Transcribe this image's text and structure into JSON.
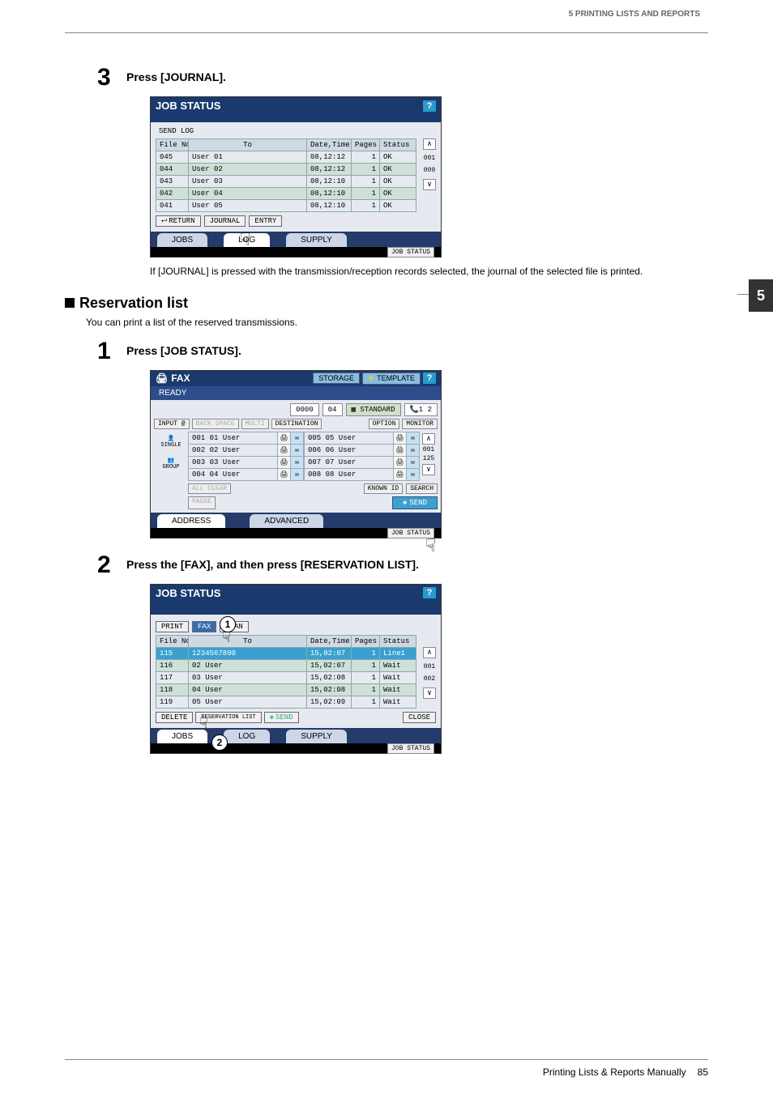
{
  "header": {
    "chapter_title": "5 PRINTING LISTS AND REPORTS",
    "side_tab": "5"
  },
  "step3": {
    "num": "3",
    "text": "Press [JOURNAL].",
    "note": "If [JOURNAL] is pressed with the transmission/reception records selected, the journal of the selected file is printed."
  },
  "jobstatus1": {
    "title": "JOB STATUS",
    "help": "?",
    "sublabel": "SEND LOG",
    "cols": {
      "file": "File No.",
      "to": "To",
      "datetime": "Date,Time",
      "pages": "Pages",
      "status": "Status"
    },
    "rows": [
      {
        "file": "045",
        "to": "User 01",
        "dt": "08,12:12",
        "pg": "1",
        "st": "OK"
      },
      {
        "file": "044",
        "to": "User 02",
        "dt": "08,12:12",
        "pg": "1",
        "st": "OK"
      },
      {
        "file": "043",
        "to": "User 03",
        "dt": "08,12:10",
        "pg": "1",
        "st": "OK"
      },
      {
        "file": "042",
        "to": "User 04",
        "dt": "08,12:10",
        "pg": "1",
        "st": "OK"
      },
      {
        "file": "041",
        "to": "User 05",
        "dt": "08,12:10",
        "pg": "1",
        "st": "OK"
      }
    ],
    "scroll": {
      "top": "001",
      "bot": "009"
    },
    "btns": {
      "return": "RETURN",
      "journal": "JOURNAL",
      "entry": "ENTRY"
    },
    "tabs": {
      "jobs": "JOBS",
      "log": "LOG",
      "supply": "SUPPLY"
    },
    "pill": "JOB STATUS"
  },
  "section": {
    "title": "Reservation list",
    "desc": "You can print a list of the reserved transmissions."
  },
  "step1": {
    "num": "1",
    "text": "Press [JOB STATUS]."
  },
  "fax": {
    "title": "FAX",
    "storage": "STORAGE",
    "template": "TEMPLATE",
    "help": "?",
    "ready": "READY",
    "disp_num": "0000",
    "disp_pg": "04",
    "standard": "STANDARD",
    "lines": "1 2",
    "input": "INPUT @",
    "backspace": "BACK SPACE",
    "multi": "MULTI",
    "destination": "DESTINATION",
    "option": "OPTION",
    "monitor": "MONITOR",
    "side": {
      "single": "SINGLE",
      "group": "GROUP"
    },
    "left": [
      {
        "n": "001",
        "u": "01 User"
      },
      {
        "n": "002",
        "u": "02 User"
      },
      {
        "n": "003",
        "u": "03 User"
      },
      {
        "n": "004",
        "u": "04 User"
      }
    ],
    "right": [
      {
        "n": "005",
        "u": "05 User"
      },
      {
        "n": "006",
        "u": "06 User"
      },
      {
        "n": "007",
        "u": "07 User"
      },
      {
        "n": "008",
        "u": "08 User"
      }
    ],
    "scroll": {
      "top": "001",
      "bot": "125"
    },
    "allclear": "ALL CLEAR",
    "knownid": "KNOWN ID",
    "search": "SEARCH",
    "pause": "PAUSE",
    "send": "SEND",
    "address": "ADDRESS",
    "advanced": "ADVANCED",
    "pill": "JOB STATUS"
  },
  "step2": {
    "num": "2",
    "text": "Press the [FAX], and then press [RESERVATION LIST]."
  },
  "jobstatus2": {
    "title": "JOB STATUS",
    "help": "?",
    "toptabs": {
      "print": "PRINT",
      "fax": "FAX",
      "scan": "SCAN"
    },
    "cols": {
      "file": "File No.",
      "to": "To",
      "datetime": "Date,Time",
      "pages": "Pages",
      "status": "Status"
    },
    "rows": [
      {
        "file": "115",
        "to": "1234567890",
        "dt": "15,02:07",
        "pg": "1",
        "st": "Line1"
      },
      {
        "file": "116",
        "to": "02 User",
        "dt": "15,02:07",
        "pg": "1",
        "st": "Wait"
      },
      {
        "file": "117",
        "to": "03 User",
        "dt": "15,02:08",
        "pg": "1",
        "st": "Wait"
      },
      {
        "file": "118",
        "to": "04 User",
        "dt": "15,02:08",
        "pg": "1",
        "st": "Wait"
      },
      {
        "file": "119",
        "to": "05 User",
        "dt": "15,02:09",
        "pg": "1",
        "st": "Wait"
      }
    ],
    "scroll": {
      "top": "001",
      "bot": "002"
    },
    "btns": {
      "delete": "DELETE",
      "reslist": "RESERVATION LIST",
      "send": "SEND",
      "close": "CLOSE"
    },
    "tabs": {
      "jobs": "JOBS",
      "log": "LOG",
      "supply": "SUPPLY"
    },
    "pill": "JOB STATUS",
    "callout1": "1",
    "callout2": "2"
  },
  "footer": {
    "title": "Printing Lists & Reports Manually",
    "page": "85"
  }
}
